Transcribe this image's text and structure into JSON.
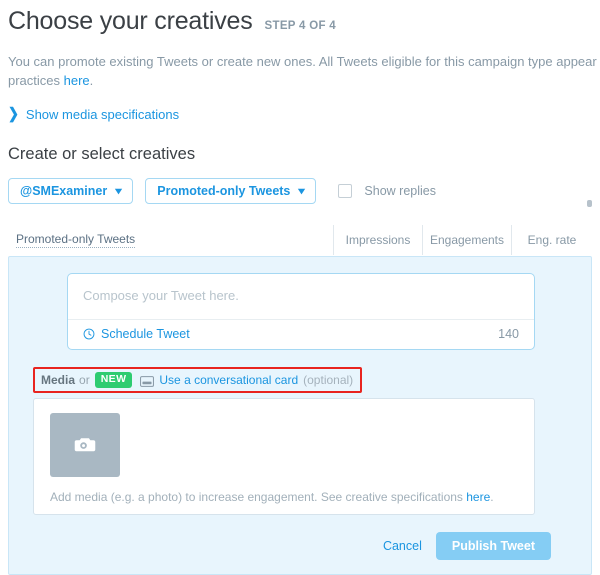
{
  "header": {
    "title": "Choose your creatives",
    "step": "STEP 4 OF 4"
  },
  "intro": {
    "line1": "You can promote existing Tweets or create new ones. All Tweets eligible for this campaign type appear below.",
    "line2_prefix": "practices ",
    "line2_link": "here",
    "line2_suffix": "."
  },
  "show_specs": {
    "icon": "chevron-right-icon",
    "chevron": "❯",
    "label": "Show media specifications"
  },
  "create_section": {
    "title": "Create or select creatives"
  },
  "filters": {
    "account": {
      "label": "@SMExaminer",
      "caret": "⌵"
    },
    "tweet_type": {
      "label": "Promoted-only Tweets",
      "caret": "⌵"
    },
    "show_replies": {
      "label": "Show replies",
      "checked": false
    }
  },
  "table": {
    "columns": [
      {
        "label": "Promoted-only Tweets",
        "align": "left"
      },
      {
        "label": "Impressions",
        "align": "center"
      },
      {
        "label": "Engagements",
        "align": "center"
      },
      {
        "label": "Eng. rate",
        "align": "center"
      }
    ]
  },
  "composer": {
    "placeholder": "Compose your Tweet here.",
    "value": "",
    "schedule_label": "Schedule Tweet",
    "schedule_icon": "clock-icon",
    "char_count": "140"
  },
  "media_header": {
    "media_label": "Media",
    "or_label": "or",
    "badge": "NEW",
    "card_icon": "conversational-card-icon",
    "link_label": "Use a conversational card",
    "optional_label": "(optional)"
  },
  "media_card": {
    "thumb_icon": "camera-icon",
    "hint_prefix": "Add media (e.g. a photo) to increase engagement. See creative specifications ",
    "hint_link": "here",
    "hint_suffix": "."
  },
  "footer": {
    "cancel_label": "Cancel",
    "publish_label": "Publish Tweet"
  },
  "colors": {
    "accent_blue": "#1b95e0",
    "panel_bg": "#e8f5fd",
    "panel_border": "#c9e6f7",
    "badge_green": "#2ecc71",
    "highlight_red": "#e8241f",
    "publish_button": "#85cdf4",
    "muted_text": "#8899a6"
  }
}
